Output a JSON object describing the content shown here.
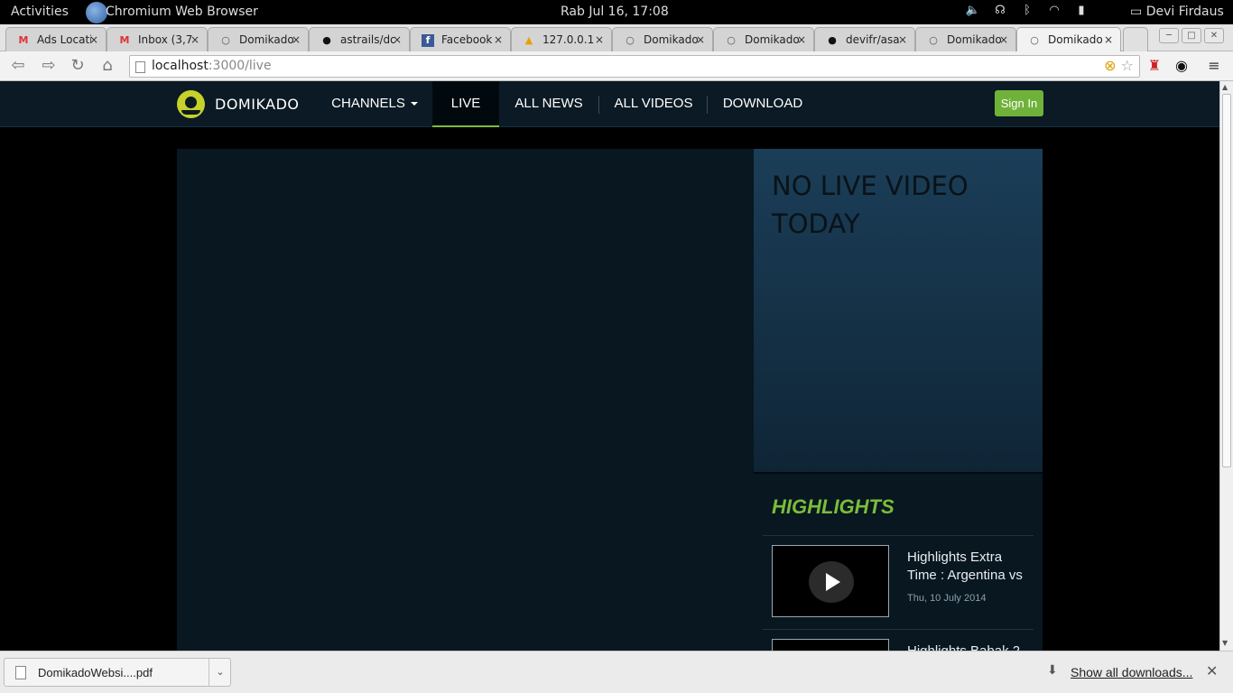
{
  "system_bar": {
    "activities": "Activities",
    "app_name": "Chromium Web Browser",
    "clock": "Rab Jul 16, 17:08",
    "user": "Devi Firdaus",
    "icons": [
      "volume-icon",
      "headphones-icon",
      "bluetooth-icon",
      "wifi-icon",
      "battery-icon"
    ]
  },
  "tabs": [
    {
      "label": "Ads Locatio",
      "favicon": "M"
    },
    {
      "label": "Inbox (3,7",
      "favicon": "M"
    },
    {
      "label": "Domikado",
      "favicon": "○"
    },
    {
      "label": "astrails/do",
      "favicon": "●"
    },
    {
      "label": "Facebook",
      "favicon": "f"
    },
    {
      "label": "127.0.0.1",
      "favicon": "▲"
    },
    {
      "label": "Domikado",
      "favicon": "○"
    },
    {
      "label": "Domikado",
      "favicon": "○"
    },
    {
      "label": "devifr/asan",
      "favicon": "●"
    },
    {
      "label": "Domikado",
      "favicon": "○"
    },
    {
      "label": "Domikado",
      "favicon": "○"
    }
  ],
  "toolbar": {
    "url_host": "localhost",
    "url_path": ":3000/live"
  },
  "site": {
    "logo": "DOMIKADO",
    "nav": {
      "channels": "CHANNELS",
      "live": "LIVE",
      "all_news": "ALL NEWS",
      "all_videos": "ALL VIDEOS",
      "download": "DOWNLOAD"
    },
    "signin": "Sign In",
    "no_live": "NO LIVE VIDEO TODAY",
    "highlights_heading": "HIGHLIGHTS",
    "highlights": [
      {
        "title": "Highlights Extra Time : Argentina vs",
        "date": "Thu, 10 July 2014"
      },
      {
        "title": "Highlights Babak 2",
        "date": ""
      }
    ]
  },
  "downloads": {
    "file": "DomikadoWebsi....pdf",
    "show_all": "Show all downloads..."
  },
  "colors": {
    "accent_green": "#7bbd3a",
    "logo_yellow": "#c6d12a",
    "header_bg": "#0b1a24"
  }
}
